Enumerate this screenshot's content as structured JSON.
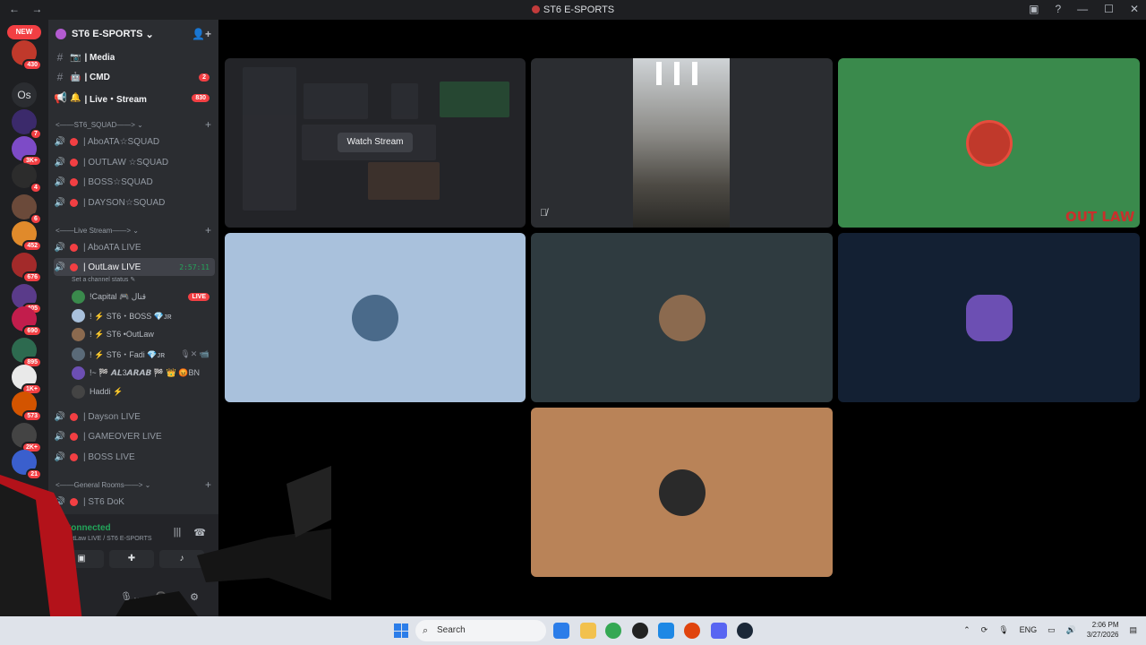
{
  "window": {
    "title": "ST6 E-SPORTS",
    "back_icon": "←",
    "forward_icon": "→"
  },
  "server_rail": {
    "new_badge": "NEW",
    "servers": [
      {
        "label": "",
        "count": "430",
        "color": "#c0392b"
      },
      {
        "label": "Os",
        "count": "",
        "color": "#2b2d31"
      },
      {
        "label": "",
        "count": "7",
        "color": "#3b2a6b"
      },
      {
        "label": "",
        "count": "3K+",
        "color": "#7d4bc7"
      },
      {
        "label": "",
        "count": "4",
        "color": "#2c2c2c"
      },
      {
        "label": "",
        "count": "6",
        "color": "#6b4a3a"
      },
      {
        "label": "",
        "count": "452",
        "color": "#e08a2b"
      },
      {
        "label": "",
        "count": "676",
        "color": "#a32a2a"
      },
      {
        "label": "",
        "count": "405",
        "color": "#5a3b8a"
      },
      {
        "label": "",
        "count": "690",
        "color": "#c21d4c"
      },
      {
        "label": "",
        "count": "895",
        "color": "#2d6a4f"
      },
      {
        "label": "",
        "count": "1K+",
        "color": "#e9e9e9"
      },
      {
        "label": "",
        "count": "573",
        "color": "#d35400"
      },
      {
        "label": "",
        "count": "2K+",
        "color": "#444"
      },
      {
        "label": "",
        "count": "21",
        "color": "#3a5fcd"
      }
    ]
  },
  "guild": {
    "name": "ST6 E-SPORTS",
    "chevron": "⌄",
    "invite_icon": "👤+"
  },
  "text_channels": [
    {
      "icon": "📷",
      "name": "| Media",
      "badge": ""
    },
    {
      "icon": "🤖",
      "name": "| CMD",
      "badge": "2"
    },
    {
      "icon": "🔔",
      "name": "| Live・Stream",
      "badge": "830"
    }
  ],
  "categories": {
    "squad": "<——ST6_SQUAD——>",
    "live": "<——Live Stream——>",
    "general": "<——General Rooms——>"
  },
  "squad_channels": [
    "| AboATA☆SQUAD",
    "| OUTLAW ☆SQUAD",
    "| BOSS☆SQUAD",
    "| DAYSON☆SQUAD"
  ],
  "live_channels": {
    "first": "| AboATA LIVE",
    "active": "| OutLaw LIVE",
    "active_timer": "2:57:11",
    "status_placeholder": "Set a channel status ✎",
    "after": [
      "| Dayson LIVE",
      "| GAMEOVER LIVE",
      "| BOSS LIVE"
    ]
  },
  "voice_members": [
    {
      "name": "!Capital 🎮 قتال",
      "tag": "LIVE"
    },
    {
      "name": "! ⚡ ST6・BOSS 💎ᴊʀ",
      "tag": ""
    },
    {
      "name": "! ⚡ ST6 •OutLaw",
      "tag": ""
    },
    {
      "name": "! ⚡ ST6・Fadi 💎ᴊʀ",
      "tag": "🎙✕ 📹"
    },
    {
      "name": "!~ 🏁 𝘼𝙇3𝘼𝙍𝘼𝘽 🏁 👑 😡BN",
      "tag": ""
    },
    {
      "name": "Haddi ⚡",
      "tag": ""
    }
  ],
  "general_channels": [
    "| ST6 DoK"
  ],
  "voice_panel": {
    "status": "Connected",
    "location": "OutLaw LIVE / ST6 E-SPORTS",
    "settings_icon": "⚙"
  },
  "stage": {
    "watch_stream_label": "Watch Stream",
    "tiles": [
      {
        "kind": "stream",
        "bg": "#232428"
      },
      {
        "kind": "camera",
        "bg": "#2b2d31"
      },
      {
        "kind": "avatar",
        "bg": "#3a8a4c"
      },
      {
        "kind": "avatar",
        "bg": "#a9c1dc"
      },
      {
        "kind": "avatar",
        "bg": "#2f3b40"
      },
      {
        "kind": "avatar",
        "bg": "#132033"
      },
      {
        "kind": "avatar",
        "bg": "#b98358"
      }
    ],
    "overlay_logo": "OUT LAW"
  },
  "taskbar": {
    "search_placeholder": "Search",
    "tray_lang": "ENG",
    "time": "2:06 PM",
    "date": "3/27/2026"
  }
}
